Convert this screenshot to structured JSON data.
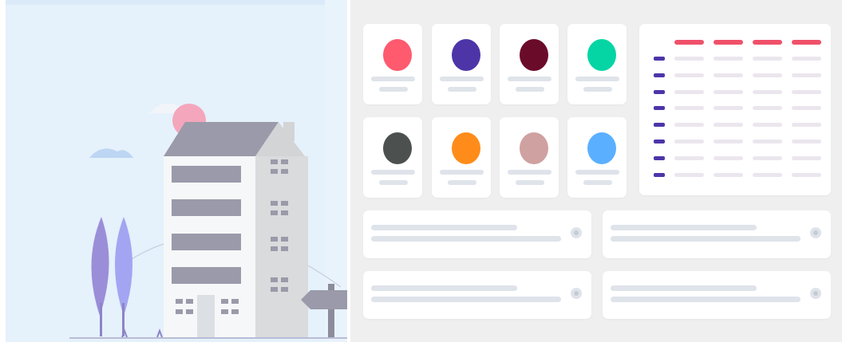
{
  "illustration": {
    "icons": [
      "building-icon",
      "tree-icon",
      "sun-icon",
      "cloud-icon",
      "signpost-icon"
    ]
  },
  "dashboard": {
    "avatars": [
      {
        "color": "#ff5a6e",
        "icon": "avatar-icon"
      },
      {
        "color": "#4d35a8",
        "icon": "avatar-icon"
      },
      {
        "color": "#6b0b2a",
        "icon": "avatar-icon"
      },
      {
        "color": "#05d5a4",
        "icon": "avatar-icon"
      },
      {
        "color": "#4c5150",
        "icon": "avatar-icon"
      },
      {
        "color": "#ff8c1a",
        "icon": "avatar-icon"
      },
      {
        "color": "#cfa1a0",
        "icon": "avatar-icon"
      },
      {
        "color": "#5ab0ff",
        "icon": "avatar-icon"
      }
    ],
    "table": {
      "header_color": "#f0516a",
      "row_marker_color": "#4d35a8",
      "cell_color": "#ebe6ee"
    },
    "list_cards": [
      {
        "icon": "radio-icon"
      },
      {
        "icon": "radio-icon"
      },
      {
        "icon": "radio-icon"
      },
      {
        "icon": "radio-icon"
      }
    ]
  }
}
